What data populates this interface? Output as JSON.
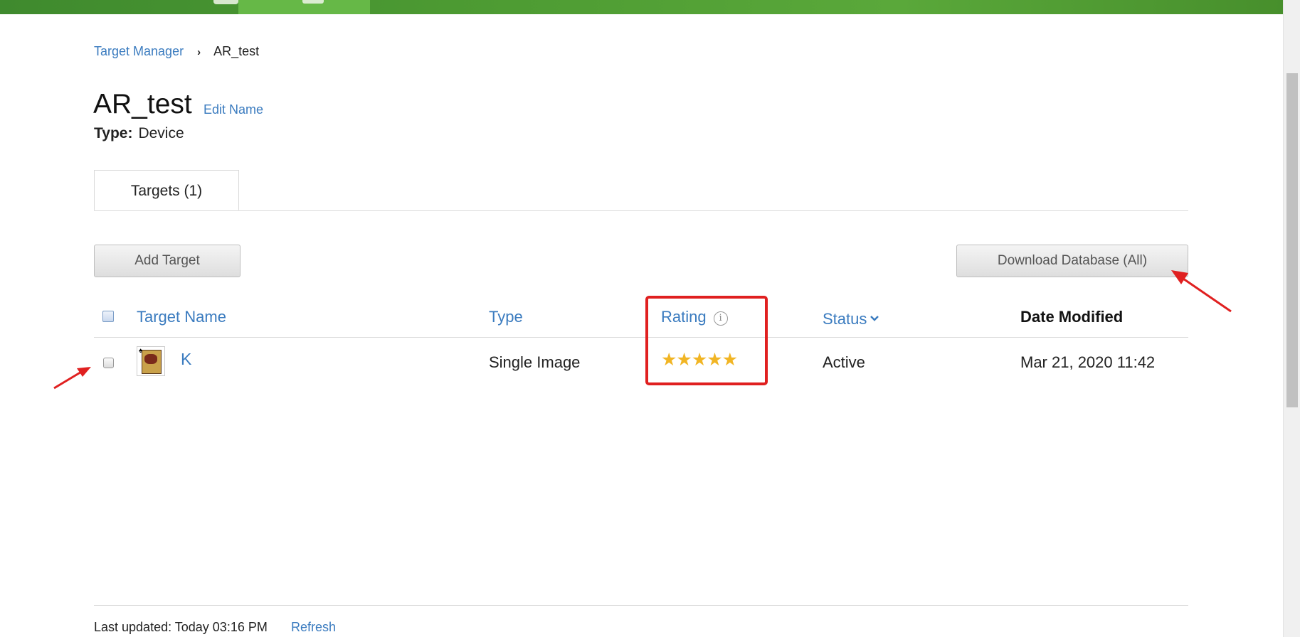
{
  "breadcrumb": {
    "root": "Target Manager",
    "current": "AR_test"
  },
  "database": {
    "name": "AR_test",
    "edit_label": "Edit Name",
    "type_label": "Type:",
    "type_value": "Device"
  },
  "tabs": [
    {
      "label": "Targets (1)"
    }
  ],
  "toolbar": {
    "add_label": "Add Target",
    "download_label": "Download Database (All)"
  },
  "table": {
    "headers": {
      "name": "Target Name",
      "type": "Type",
      "rating": "Rating",
      "status": "Status",
      "date": "Date Modified"
    },
    "rows": [
      {
        "name": "K",
        "type": "Single Image",
        "rating": 5,
        "rating_display": "★★★★★",
        "status": "Active",
        "date": "Mar 21, 2020 11:42"
      }
    ]
  },
  "footer": {
    "updated": "Last updated: Today 03:16 PM",
    "refresh_label": "Refresh"
  },
  "icons": {
    "info": "info-icon",
    "chevron": "chevron-down-icon",
    "breadcrumb_sep": "chevron-right-icon",
    "thumbnail": "playing-card-thumbnail"
  },
  "colors": {
    "link": "#3a7bbf",
    "star": "#f1b524",
    "annotation": "#e02020",
    "header_green": "#4e9c33"
  }
}
